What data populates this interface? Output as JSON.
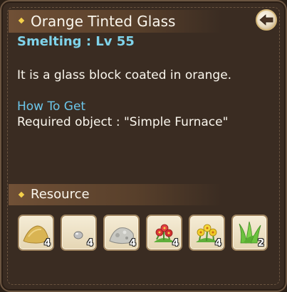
{
  "item": {
    "title": "Orange Tinted Glass",
    "level": "Smelting : Lv 55",
    "description": "It is a glass block coated in orange."
  },
  "how_to_get": {
    "label": "How To Get",
    "text": "Required object : \"Simple Furnace\""
  },
  "resource": {
    "label": "Resource",
    "items": [
      {
        "icon": "sand-pile-icon",
        "count": "4"
      },
      {
        "icon": "small-pebble-icon",
        "count": "4"
      },
      {
        "icon": "stone-rubble-icon",
        "count": "4"
      },
      {
        "icon": "red-flower-icon",
        "count": "4"
      },
      {
        "icon": "yellow-flower-icon",
        "count": "4"
      },
      {
        "icon": "grass-icon",
        "count": "2"
      }
    ]
  },
  "colors": {
    "accent_cyan": "#7fd3ea",
    "text": "#fbf7ee",
    "panel": "#3a2c22"
  }
}
